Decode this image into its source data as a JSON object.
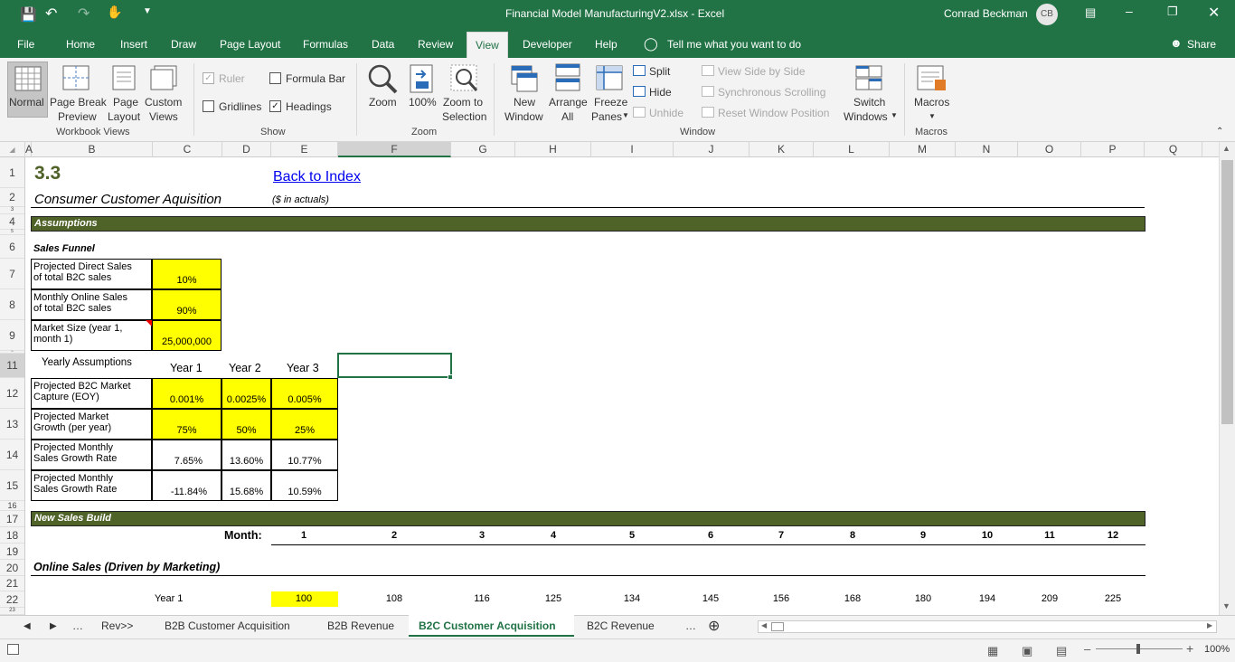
{
  "window": {
    "title": "Financial Model ManufacturingV2.xlsx  -  Excel",
    "user": "Conrad Beckman",
    "user_initials": "CB"
  },
  "ribbon_tabs": [
    "File",
    "Home",
    "Insert",
    "Draw",
    "Page Layout",
    "Formulas",
    "Data",
    "Review",
    "View",
    "Developer",
    "Help"
  ],
  "active_tab": "View",
  "tell_me": "Tell me what you want to do",
  "share": "Share",
  "ribbon": {
    "workbook_views": {
      "group": "Workbook Views",
      "normal": "Normal",
      "page_break": [
        "Page Break",
        "Preview"
      ],
      "page_layout": [
        "Page",
        "Layout"
      ],
      "custom": [
        "Custom",
        "Views"
      ]
    },
    "show": {
      "group": "Show",
      "ruler": "Ruler",
      "gridlines": "Gridlines",
      "formula_bar": "Formula Bar",
      "headings": "Headings",
      "ruler_checked": true,
      "gridlines_checked": false,
      "formula_bar_checked": false,
      "headings_checked": true
    },
    "zoom": {
      "group": "Zoom",
      "zoom": "Zoom",
      "hundred": "100%",
      "zoom_to_selection": [
        "Zoom to",
        "Selection"
      ]
    },
    "window": {
      "group": "Window",
      "new_window": [
        "New",
        "Window"
      ],
      "arrange_all": [
        "Arrange",
        "All"
      ],
      "freeze_panes": [
        "Freeze",
        "Panes"
      ],
      "split": "Split",
      "hide": "Hide",
      "unhide": "Unhide",
      "view_side": "View Side by Side",
      "sync_scroll": "Synchronous Scrolling",
      "reset_pos": "Reset Window Position",
      "switch_windows": [
        "Switch",
        "Windows"
      ]
    },
    "macros": {
      "group": "Macros",
      "macros": "Macros"
    }
  },
  "columns": [
    "A",
    "B",
    "C",
    "D",
    "E",
    "F",
    "G",
    "H",
    "I",
    "J",
    "K",
    "L",
    "M",
    "N",
    "O",
    "P",
    "Q"
  ],
  "rows": [
    "1",
    "2",
    "3",
    "4",
    "5",
    "6",
    "7",
    "8",
    "9",
    "10",
    "11",
    "12",
    "13",
    "14",
    "15",
    "16",
    "17",
    "18",
    "19",
    "20",
    "21",
    "22",
    "23"
  ],
  "sheet": {
    "section_number": "3.3",
    "back_link": "Back to Index",
    "title": "Consumer Customer Aquisition",
    "units": "($ in actuals)",
    "assumptions": "Assumptions",
    "sales_funnel": "Sales Funnel",
    "funnel": [
      {
        "label": [
          "Projected Direct Sales",
          "of total B2C sales"
        ],
        "value": "10%"
      },
      {
        "label": [
          "Monthly Online Sales",
          "of total B2C sales"
        ],
        "value": "90%"
      },
      {
        "label": [
          "Market Size (year 1,",
          "month 1)"
        ],
        "value": "25,000,000"
      }
    ],
    "yearly_assumptions": "Yearly Assumptions",
    "year_headers": [
      "Year 1",
      "Year 2",
      "Year 3"
    ],
    "yearly": [
      {
        "label": [
          "Projected B2C Market",
          "Capture (EOY)"
        ],
        "values": [
          "0.001%",
          "0.0025%",
          "0.005%"
        ],
        "yellow": true
      },
      {
        "label": [
          "Projected Market",
          "Growth (per year)"
        ],
        "values": [
          "75%",
          "50%",
          "25%"
        ],
        "yellow": true
      },
      {
        "label": [
          "Projected Monthly",
          "Sales Growth Rate"
        ],
        "values": [
          "7.65%",
          "13.60%",
          "10.77%"
        ],
        "yellow": false
      },
      {
        "label": [
          "Projected Monthly",
          "Sales Growth Rate"
        ],
        "values": [
          "-11.84%",
          "15.68%",
          "10.59%"
        ],
        "yellow": false
      }
    ],
    "new_sales_build": "New Sales Build",
    "month_label": "Month:",
    "months": [
      "1",
      "2",
      "3",
      "4",
      "5",
      "6",
      "7",
      "8",
      "9",
      "10",
      "11",
      "12"
    ],
    "online_sales": "Online Sales (Driven by Marketing)",
    "year1_label": "Year 1",
    "year1_values": [
      "100",
      "108",
      "116",
      "125",
      "134",
      "145",
      "156",
      "168",
      "180",
      "194",
      "209",
      "225"
    ]
  },
  "sheet_tabs": [
    "Rev>>",
    "B2B Customer Acquisition",
    "B2B Revenue",
    "B2C Customer Acquisition",
    "B2C Revenue"
  ],
  "active_sheet": "B2C Customer Acquisition",
  "zoom_level": "100%",
  "colors": {
    "excel_green": "#217346",
    "band_green": "#4f6228",
    "input_yellow": "#ffff00"
  }
}
